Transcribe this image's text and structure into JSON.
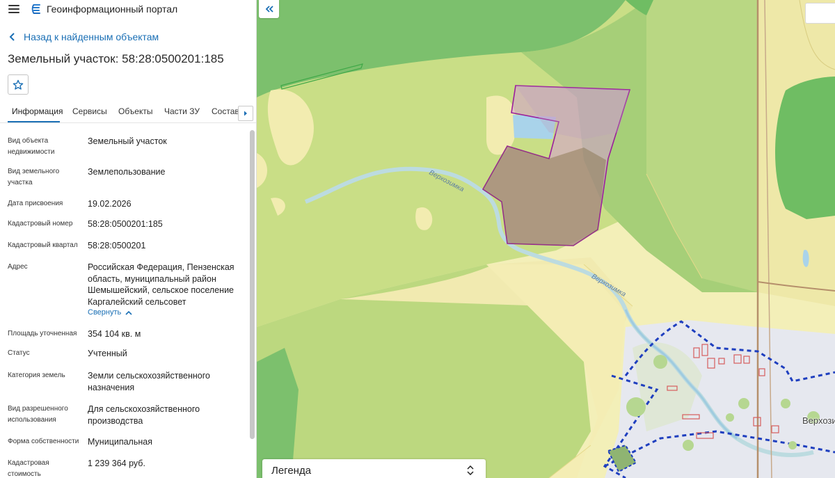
{
  "app": {
    "title": "Геоинформационный портал"
  },
  "nav": {
    "back_label": "Назад к найденным объектам"
  },
  "object": {
    "title": "Земельный участок: 58:28:0500201:185"
  },
  "tabs": [
    {
      "label": "Информация"
    },
    {
      "label": "Сервисы"
    },
    {
      "label": "Объекты"
    },
    {
      "label": "Части ЗУ"
    },
    {
      "label": "Состав"
    }
  ],
  "active_tab": "Информация",
  "fields": [
    {
      "label": "Вид объекта недвижимости",
      "value": "Земельный участок"
    },
    {
      "label": "Вид земельного участка",
      "value": "Землепользование"
    },
    {
      "label": "Дата присвоения",
      "value": "19.02.2026"
    },
    {
      "label": "Кадастровый номер",
      "value": "58:28:0500201:185"
    },
    {
      "label": "Кадастровый квартал",
      "value": "58:28:0500201"
    },
    {
      "label": "Адрес",
      "value": "Российская Федерация, Пензенская область, муниципальный район Шемышейский, сельское поселение Каргалейский сельсовет"
    },
    {
      "label": "Площадь уточненная",
      "value": "354 104 кв. м"
    },
    {
      "label": "Статус",
      "value": "Учтенный"
    },
    {
      "label": "Категория земель",
      "value": "Земли сельскохозяйственного назначения"
    },
    {
      "label": "Вид разрешенного использования",
      "value": "Для сельскохозяйственного производства"
    },
    {
      "label": "Форма собственности",
      "value": "Муниципальная"
    },
    {
      "label": "Кадастровая стоимость",
      "value": "1 239 364 руб."
    }
  ],
  "address_toggle": "Свернуть",
  "map": {
    "place_label": "Верхозим",
    "river_labels": [
      "Верхозимка",
      "Верхозимка"
    ],
    "legend_label": "Легенда"
  },
  "colors": {
    "accent": "#1a6fb5",
    "parcel_outline": "#9b1f9b",
    "settlement_border": "#1f3fbf"
  },
  "icons": {
    "menu": "hamburger-icon",
    "logo": "portal-logo-icon",
    "back": "chevron-left-icon",
    "favorite": "star-outline-icon",
    "tabs_next": "chevron-right-icon",
    "map_collapse": "double-chevron-left-icon",
    "legend_toggle": "chevron-updown-icon"
  }
}
